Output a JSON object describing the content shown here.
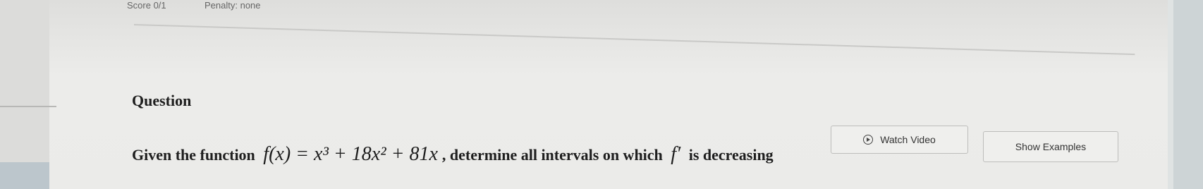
{
  "header": {
    "score": "Score 0/1",
    "penalty": "Penalty: none"
  },
  "question": {
    "label": "Question",
    "prompt_start": "Given the function",
    "function_expression": "f(x) = x³ + 18x² + 81x",
    "prompt_middle": ", determine all intervals on which",
    "derivative_symbol": "f′",
    "prompt_end": "is decreasing"
  },
  "buttons": {
    "watch_video": "Watch Video",
    "show_examples": "Show Examples"
  },
  "icons": {
    "watch_video": "play-circle-icon"
  }
}
